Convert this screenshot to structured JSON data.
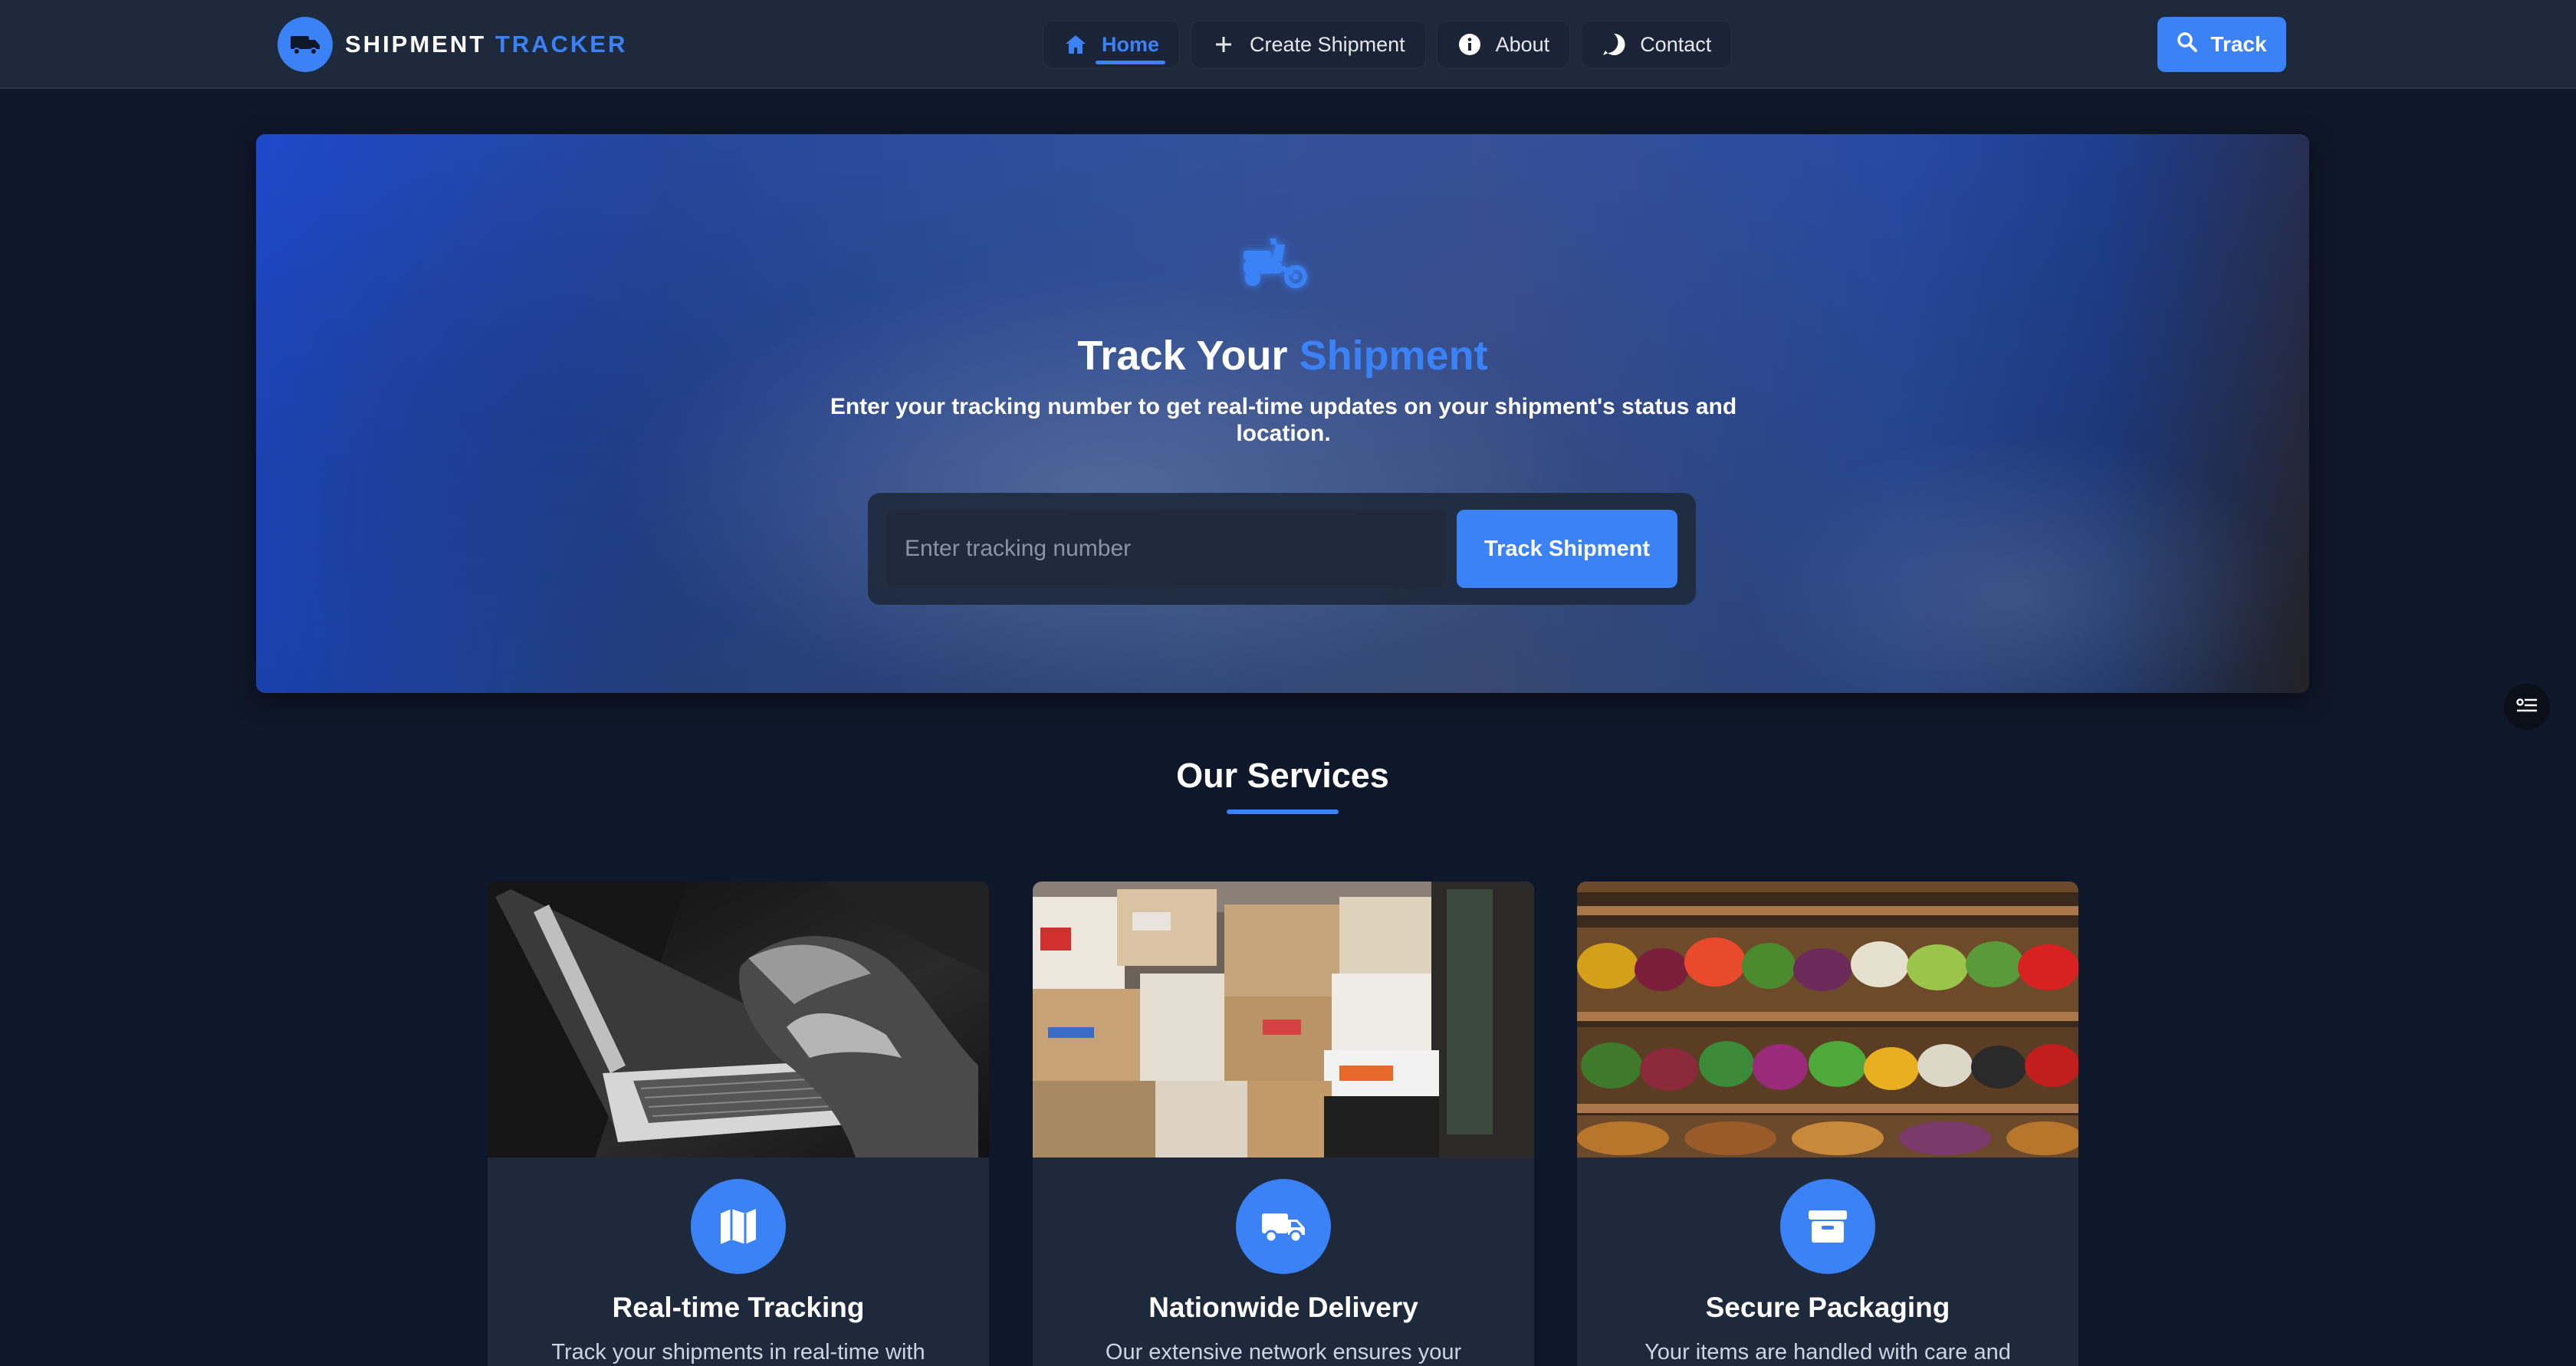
{
  "brand": {
    "name_part1": "SHIPMENT",
    "name_part2": "TRACKER",
    "logo_icon": "truck-icon"
  },
  "nav": {
    "items": [
      {
        "label": "Home",
        "icon": "home-icon",
        "active": true
      },
      {
        "label": "Create Shipment",
        "icon": "plus-icon",
        "active": false
      },
      {
        "label": "About",
        "icon": "info-icon",
        "active": false
      },
      {
        "label": "Contact",
        "icon": "question-icon",
        "active": false
      }
    ],
    "track_button": {
      "label": "Track",
      "icon": "search-icon"
    }
  },
  "hero": {
    "icon": "scooter-icon",
    "title_part1": "Track Your",
    "title_part2": "Shipment",
    "subtitle": "Enter your tracking number to get real-time updates on your shipment's status and location.",
    "search_placeholder": "Enter tracking number",
    "search_value": "",
    "search_button": "Track Shipment"
  },
  "services": {
    "title": "Our Services",
    "cards": [
      {
        "title": "Real-time Tracking",
        "icon": "map-icon",
        "image": "laptop-typing-photo",
        "text": "Track your shipments in real-time with"
      },
      {
        "title": "Nationwide Delivery",
        "icon": "truck-icon",
        "image": "warehouse-boxes-photo",
        "text": "Our extensive network ensures your"
      },
      {
        "title": "Secure Packaging",
        "icon": "archive-box-icon",
        "image": "produce-shelves-photo",
        "text": "Your items are handled with care and"
      }
    ]
  },
  "colors": {
    "background": "#0f172a",
    "navbar": "#1e293b",
    "accent": "#3b82f6",
    "card": "#1e293b"
  }
}
